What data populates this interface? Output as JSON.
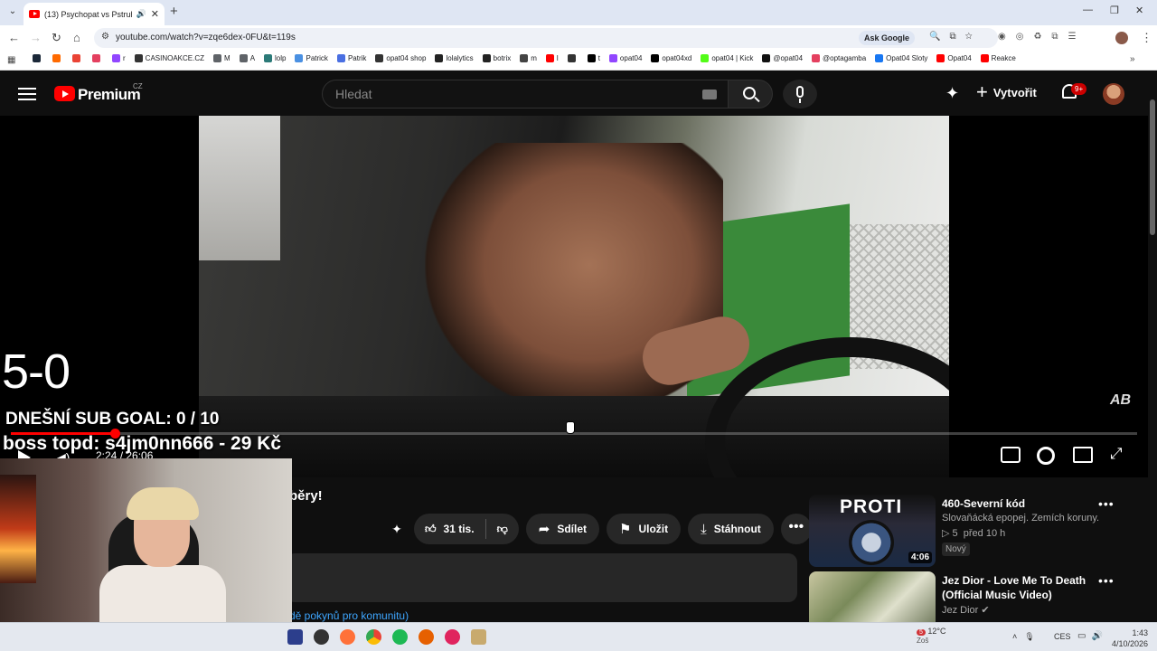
{
  "browser": {
    "tab_title": "(13) Psychopat vs Pstruh - I",
    "url": "youtube.com/watch?v=zqe6dex-0FU&t=119s",
    "ask_google": "Ask Google",
    "bookmarks": [
      {
        "label": "",
        "color": "#1b2838"
      },
      {
        "label": "",
        "color": "#ff6a00"
      },
      {
        "label": "",
        "color": "#ea4335"
      },
      {
        "label": "",
        "color": "#e4405f"
      },
      {
        "label": "r",
        "color": "#9146ff"
      },
      {
        "label": "CASINOAKCE.CZ",
        "color": "#333333"
      },
      {
        "label": "M",
        "color": "#5f6368"
      },
      {
        "label": "A",
        "color": "#5f6368"
      },
      {
        "label": "lolp",
        "color": "#2b7a78"
      },
      {
        "label": "Patrick",
        "color": "#4a90e2"
      },
      {
        "label": "Patrik",
        "color": "#4a6fe2"
      },
      {
        "label": "opat04 shop",
        "color": "#333333"
      },
      {
        "label": "lolalytics",
        "color": "#222222"
      },
      {
        "label": "botrix",
        "color": "#222222"
      },
      {
        "label": "m",
        "color": "#444444"
      },
      {
        "label": "l",
        "color": "#ff0000"
      },
      {
        "label": "",
        "color": "#333333"
      },
      {
        "label": "t",
        "color": "#000000"
      },
      {
        "label": "opat04",
        "color": "#9146ff"
      },
      {
        "label": "opat04xd",
        "color": "#000000"
      },
      {
        "label": "opat04 | Kick",
        "color": "#53fc18"
      },
      {
        "label": "@opat04",
        "color": "#111111"
      },
      {
        "label": "@optagamba",
        "color": "#e4405f"
      },
      {
        "label": "Opat04 Sloty",
        "color": "#1877f2"
      },
      {
        "label": "Opat04",
        "color": "#ff0000"
      },
      {
        "label": "Reakce",
        "color": "#ff0000"
      }
    ]
  },
  "youtube": {
    "logo_text": "Premium",
    "country_code": "CZ",
    "search_placeholder": "Hledat",
    "create_label": "Vytvořit",
    "notif_count": "9+"
  },
  "player": {
    "overlay_score": "5-0",
    "overlay_sub_goal": "DNEŠNÍ SUB GOAL: 0 / 10",
    "overlay_boss": "boss topd:  s4jm0nn666 - 29 Kč",
    "time": "2:24 / 26:06",
    "progress_fraction": 0.092,
    "watermark": "AB"
  },
  "video": {
    "title_partial": "běry!",
    "like_count": "31 tis.",
    "share_label": "Sdílet",
    "save_label": "Uložit",
    "download_label": "Stáhnout",
    "community_link": "dě pokynů pro komunitu)"
  },
  "recommendations": [
    {
      "title": "460-Severní kód",
      "channel": "Slovaňácká epopej. Zemích koruny.",
      "meta_play": "▷ 5",
      "meta_age": "před 10 h",
      "badge": "Nový",
      "duration": "4:06",
      "thumb_text": "PROTI"
    },
    {
      "title": "Jez Dior - Love Me To Death (Official Music Video)",
      "channel": "Jez Dior",
      "verified": "✔",
      "duration": ""
    }
  ],
  "taskbar": {
    "temperature": "12°C",
    "weather_sub": "Zoš",
    "weather_badge": "5",
    "lang": "CES",
    "time": "1:43",
    "date": "4/10/2026"
  }
}
